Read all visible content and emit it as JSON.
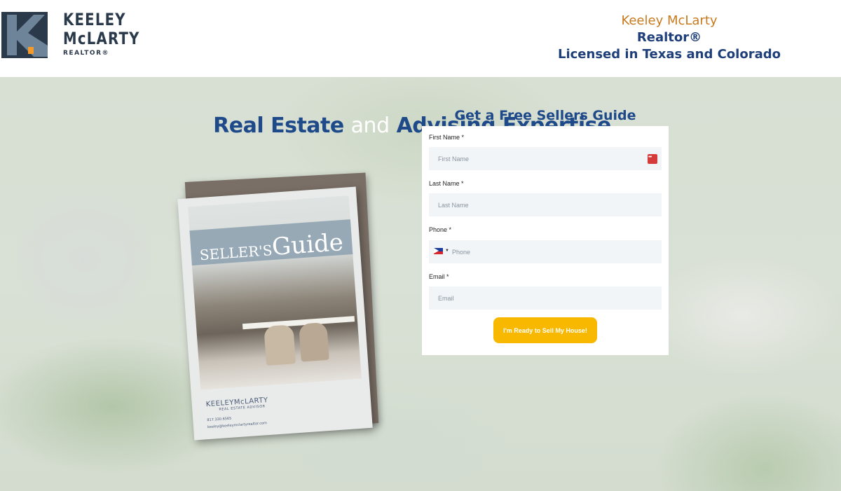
{
  "header": {
    "logo": {
      "line1": "KEELEY",
      "line2": "McLARTY",
      "line3": "REALTOR®"
    },
    "contact": {
      "name": "Keeley McLarty",
      "title": "Realtor®",
      "license": "Licensed in Texas and Colorado"
    }
  },
  "hero": {
    "title_part1": "Real Estate",
    "title_and": "and",
    "title_part2": "Advising Expertise"
  },
  "booklet": {
    "title_small": "SELLER'S",
    "title_big": "Guide",
    "brand": "KEELEYMcLARTY",
    "brand_sub": "REAL ESTATE ADVISOR",
    "phone": "817.330.6565",
    "email": "keeley@keeleymclartyrealtor.com"
  },
  "form": {
    "heading": "Get a Free Sellers Guide",
    "first_name": {
      "label": "First Name *",
      "placeholder": "First Name",
      "value": ""
    },
    "last_name": {
      "label": "Last Name *",
      "placeholder": "Last Name",
      "value": ""
    },
    "phone": {
      "label": "Phone *",
      "placeholder": "Phone",
      "value": ""
    },
    "email": {
      "label": "Email *",
      "placeholder": "Email",
      "value": ""
    },
    "submit_label": "I'm Ready to Sell My House!"
  },
  "colors": {
    "brand_navy": "#1f4a8a",
    "accent_orange": "#c77a1e",
    "button_yellow": "#f9b800",
    "logo_dark": "#2b3a4a"
  }
}
